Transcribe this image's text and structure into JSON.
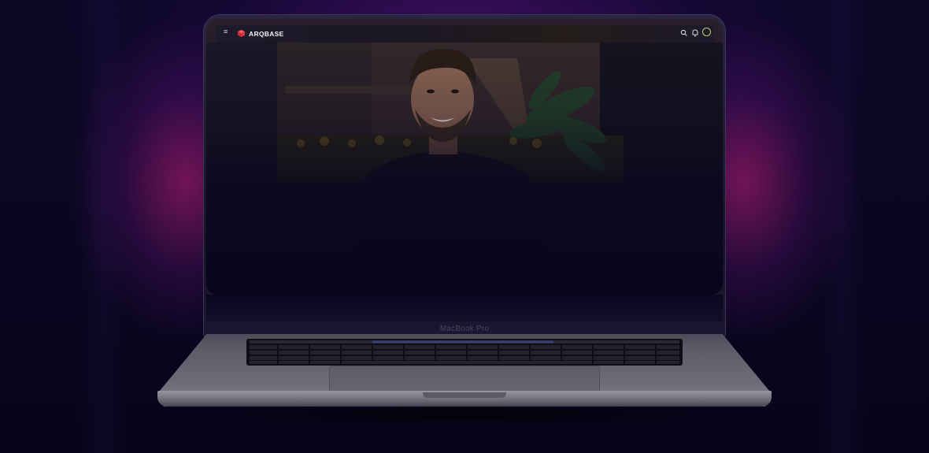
{
  "navbar": {
    "menu_icon": "hamburger-menu-icon",
    "brand_name": "ARQBASE",
    "search_icon": "search-icon",
    "bell_icon": "bell-icon",
    "avatar_icon": "avatar-ring-icon"
  },
  "device": {
    "model_label": "MacBook Pro"
  },
  "colors": {
    "background": "#07061c",
    "glow": "#c81e82",
    "brand_accent": "#e0303a",
    "avatar_ring": "#b4d66a"
  }
}
